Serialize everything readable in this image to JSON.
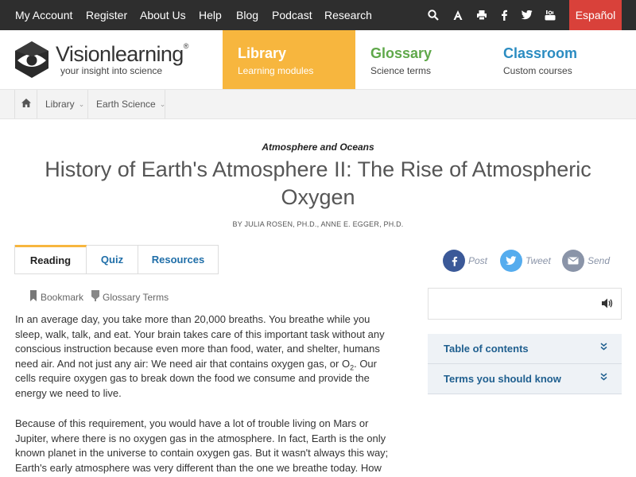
{
  "topnav": {
    "links": [
      "My Account",
      "Register",
      "About Us",
      "Help",
      "Blog",
      "Podcast",
      "Research"
    ],
    "icons": [
      "search-icon",
      "font-size-icon",
      "print-icon",
      "facebook-icon",
      "twitter-icon",
      "youtube-icon"
    ],
    "language_button": "Español"
  },
  "brand": {
    "name": "Visionlearning",
    "registered": "®",
    "tagline": "your insight into science"
  },
  "main_nav": [
    {
      "title": "Library",
      "subtitle": "Learning modules"
    },
    {
      "title": "Glossary",
      "subtitle": "Science terms"
    },
    {
      "title": "Classroom",
      "subtitle": "Custom courses"
    }
  ],
  "breadcrumb": {
    "home_icon": "home-icon",
    "items": [
      "Library",
      "Earth Science"
    ]
  },
  "article": {
    "category": "Atmosphere and Oceans",
    "title": "History of Earth's Atmosphere II: The Rise of Atmospheric Oxygen",
    "byline": "BY JULIA ROSEN, PH.D., ANNE E. EGGER, PH.D."
  },
  "content_tabs": [
    "Reading",
    "Quiz",
    "Resources"
  ],
  "share": [
    "Post",
    "Tweet",
    "Send"
  ],
  "tools": {
    "bookmark": "Bookmark",
    "glossary_terms": "Glossary Terms"
  },
  "body": {
    "p1_a": "In an average day, you take more than 20,000 breaths. You breathe while you sleep, walk, talk, and eat. Your brain takes care of this important task without any conscious instruction because even more than food, water, and shelter, humans need air. And not just any air: We need air that contains oxygen gas, or O",
    "p1_sub": "2",
    "p1_b": ". Our cells require oxygen gas to break down the food we consume and provide the energy we need to live.",
    "p2": "Because of this requirement, you would have a lot of trouble living on Mars or Jupiter, where there is no oxygen gas in the atmosphere. In fact, Earth is the only known planet in the universe to contain oxygen gas. But it wasn't always this way; Earth's early atmosphere was very different than the one we breathe today. How"
  },
  "sidebar": {
    "toc": "Table of contents",
    "terms": "Terms you should know"
  },
  "colors": {
    "topbar": "#2e2e2e",
    "espanol": "#d9413a",
    "library": "#f7b63e",
    "glossary": "#5fa84a",
    "classroom": "#2b8cc1",
    "facebook": "#3b5998",
    "twitter": "#55acee",
    "email": "#8a94a8"
  }
}
